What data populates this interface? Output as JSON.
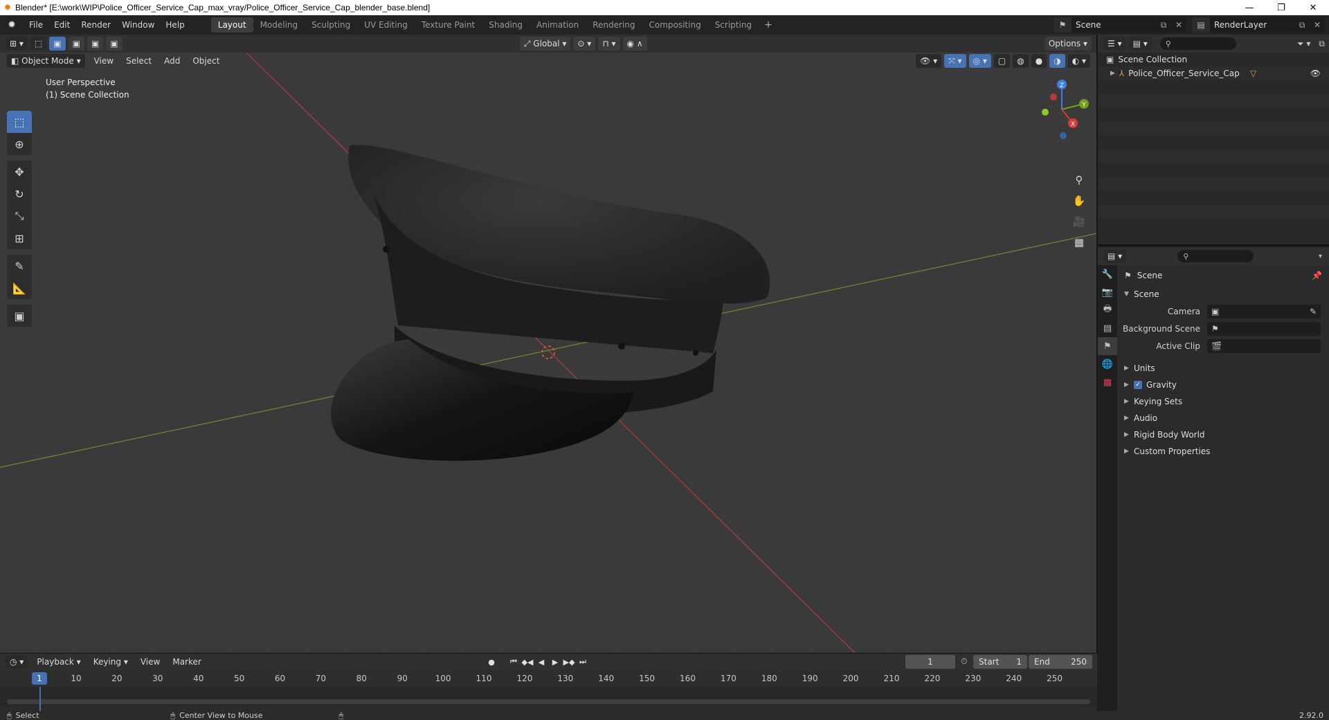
{
  "window": {
    "title": "Blender* [E:\\work\\WIP\\Police_Officer_Service_Cap_max_vray/Police_Officer_Service_Cap_blender_base.blend]",
    "minimize": "—",
    "maximize": "❐",
    "close": "✕"
  },
  "menu": [
    "File",
    "Edit",
    "Render",
    "Window",
    "Help"
  ],
  "workspaces": [
    "Layout",
    "Modeling",
    "Sculpting",
    "UV Editing",
    "Texture Paint",
    "Shading",
    "Animation",
    "Rendering",
    "Compositing",
    "Scripting"
  ],
  "active_workspace": "Layout",
  "scene_selector": "Scene",
  "renderlayer_selector": "RenderLayer",
  "viewport": {
    "mode": "Object Mode",
    "menus": [
      "View",
      "Select",
      "Add",
      "Object"
    ],
    "transform_orientation": "Global",
    "options_label": "Options",
    "info_line1": "User Perspective",
    "info_line2": "(1) Scene Collection",
    "gizmo": {
      "z": "Z",
      "y": "Y",
      "x": "X"
    }
  },
  "timeline": {
    "menus": [
      "Playback",
      "Keying",
      "View",
      "Marker"
    ],
    "current_frame": "1",
    "start_label": "Start",
    "start": "1",
    "end_label": "End",
    "end": "250",
    "ticks": [
      "1",
      "10",
      "20",
      "30",
      "40",
      "50",
      "60",
      "70",
      "80",
      "90",
      "100",
      "110",
      "120",
      "130",
      "140",
      "150",
      "160",
      "170",
      "180",
      "190",
      "200",
      "210",
      "220",
      "230",
      "240",
      "250"
    ]
  },
  "outliner": {
    "root": "Scene Collection",
    "items": [
      "Police_Officer_Service_Cap"
    ]
  },
  "properties": {
    "context": "Scene",
    "panel": "Scene",
    "fields": [
      {
        "label": "Camera",
        "value": ""
      },
      {
        "label": "Background Scene",
        "value": ""
      },
      {
        "label": "Active Clip",
        "value": ""
      }
    ],
    "panels": [
      "Units",
      "Gravity",
      "Keying Sets",
      "Audio",
      "Rigid Body World",
      "Custom Properties"
    ]
  },
  "status": {
    "select": "Select",
    "center_view": "Center View to Mouse",
    "version": "2.92.0"
  },
  "colors": {
    "accent": "#4772b3",
    "x_axis": "#d83a3a",
    "y_axis": "#72a01c",
    "z_axis": "#3d7fe6"
  }
}
